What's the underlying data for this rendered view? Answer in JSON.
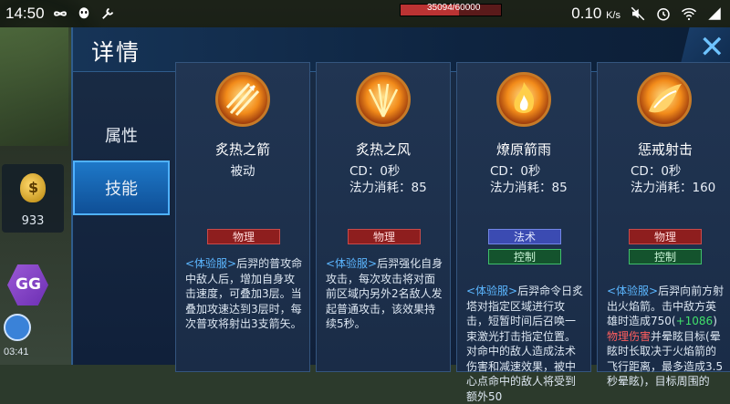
{
  "status_bar": {
    "time": "14:50",
    "net_speed": "0.10",
    "net_unit": "K/s"
  },
  "game": {
    "hp_text": "35094/60000",
    "hp_fraction": 0.58,
    "gold": "933",
    "gg_label": "GG",
    "time": "03:41"
  },
  "panel": {
    "title": "详情",
    "close_symbol": "✕",
    "tabs": [
      {
        "label": "属性"
      },
      {
        "label": "技能"
      }
    ],
    "skills": [
      {
        "name": "炙热之箭",
        "passive": "被动",
        "tags": [
          "物理"
        ],
        "desc_tag": "<体验服>",
        "desc": "后羿的普攻命中敌人后，增加自身攻击速度，可叠加3层。当叠加攻速达到3层时，每次普攻将射出3支箭矢。"
      },
      {
        "name": "炙热之风",
        "cd": "CD：0秒",
        "cost": "法力消耗：85",
        "tags": [
          "物理"
        ],
        "desc_tag": "<体验服>",
        "desc": "后羿强化自身攻击，每次攻击将对面前区域内另外2名敌人发起普通攻击，该效果持续5秒。"
      },
      {
        "name": "燎原箭雨",
        "cd": "CD：0秒",
        "cost": "法力消耗：85",
        "tags": [
          "法术",
          "控制"
        ],
        "desc_tag": "<体验服>",
        "desc": "后羿命令日炙塔对指定区域进行攻击，短暂时间后召唤一束激光打击指定位置。对命中的敌人造成法术伤害和减速效果，被中心点命中的敌人将受到额外50"
      },
      {
        "name": "惩戒射击",
        "cd": "CD：0秒",
        "cost": "法力消耗：160",
        "tags": [
          "物理",
          "控制"
        ],
        "desc_tag": "<体验服>",
        "desc_a": "后羿向前方射出火焰箭。击中敌方英雄时造成750(",
        "desc_plus": "+1086",
        "desc_b": ")",
        "desc_dmg": "物理伤害",
        "desc_c": "并晕眩目标(晕眩时长取决于火焰箭的飞行距离，最多造成3.5秒晕眩)，目标周围的"
      }
    ]
  }
}
